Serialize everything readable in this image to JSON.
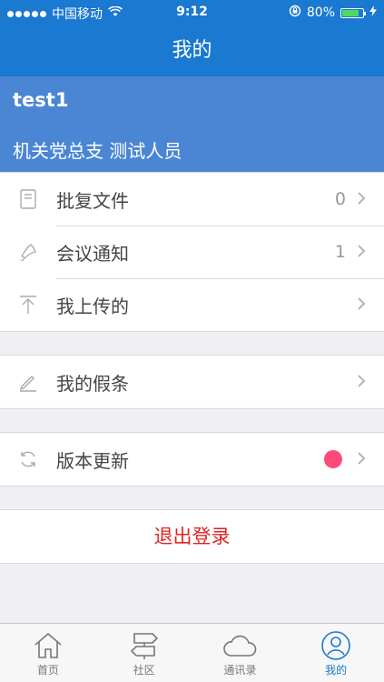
{
  "status_bar": {
    "carrier": "中国移动",
    "time": "9:12",
    "battery": "80%",
    "battery_level": 0.8
  },
  "nav": {
    "title": "我的"
  },
  "profile": {
    "username": "test1",
    "department": "机关党总支 测试人员"
  },
  "menu_group1": [
    {
      "label": "批复文件",
      "count": "0",
      "icon": "document-icon"
    },
    {
      "label": "会议通知",
      "count": "1",
      "icon": "bell-icon"
    },
    {
      "label": "我上传的",
      "count": "",
      "icon": "upload-icon"
    }
  ],
  "menu_group2": [
    {
      "label": "我的假条",
      "icon": "pencil-icon"
    }
  ],
  "menu_group3": [
    {
      "label": "版本更新",
      "icon": "refresh-icon",
      "badge_color": "#ff4a7a"
    }
  ],
  "logout": {
    "label": "退出登录"
  },
  "tabs": [
    {
      "label": "首页",
      "icon": "home-icon"
    },
    {
      "label": "社区",
      "icon": "signpost-icon"
    },
    {
      "label": "通讯录",
      "icon": "cloud-icon"
    },
    {
      "label": "我的",
      "icon": "user-icon",
      "active": true
    }
  ],
  "colors": {
    "primary": "#1a79d0",
    "profile_bg": "#4b86d4",
    "logout_text": "#e02424",
    "badge": "#ff4a7a"
  }
}
